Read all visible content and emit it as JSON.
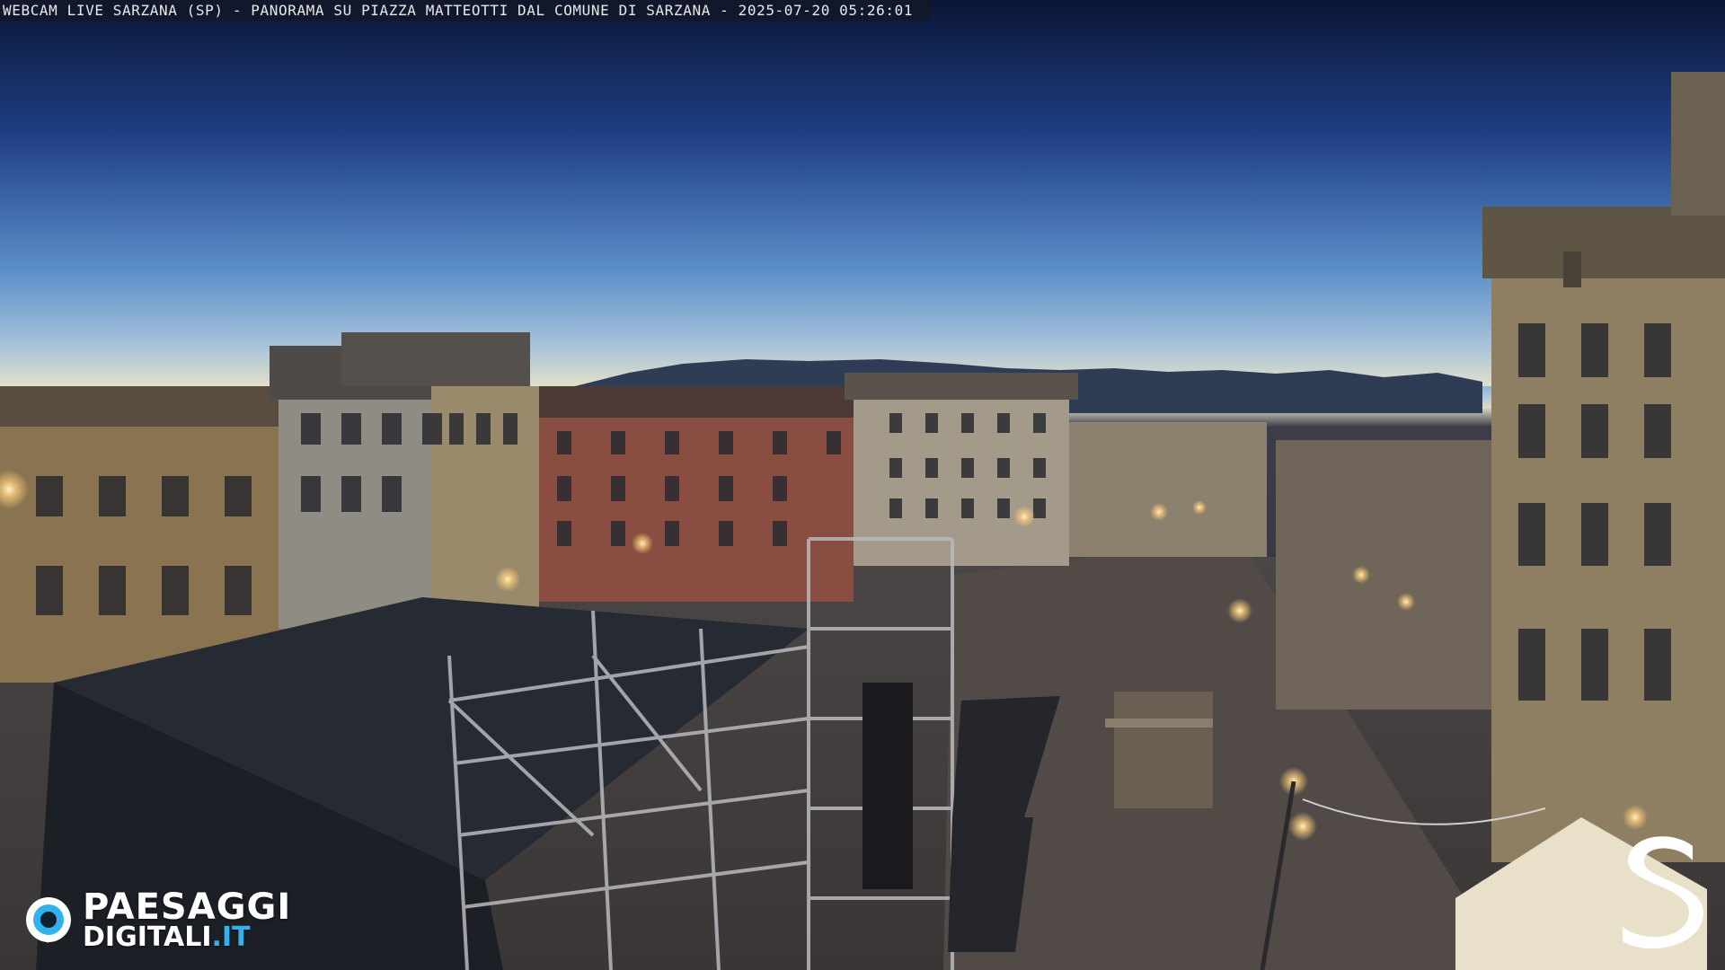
{
  "overlay": {
    "title": "WEBCAM LIVE SARZANA (SP) - PANORAMA SU PIAZZA MATTEOTTI DAL COMUNE DI SARZANA - 2025-07-20  05:26:01"
  },
  "watermark": {
    "brand_line1": "PAESAGGI",
    "brand_line2_main": "DIGITALI",
    "brand_line2_tld": ".IT",
    "accent_color": "#2fb3ea",
    "icon": "eye-icon"
  },
  "corner_logo": {
    "icon": "letter-s-logo-icon"
  },
  "colors": {
    "sky_top": "#0d1a3d",
    "sky_mid": "#2d5aa6",
    "horizon": "#dcdcc9",
    "lamp_glow": "#ffcf7a"
  }
}
